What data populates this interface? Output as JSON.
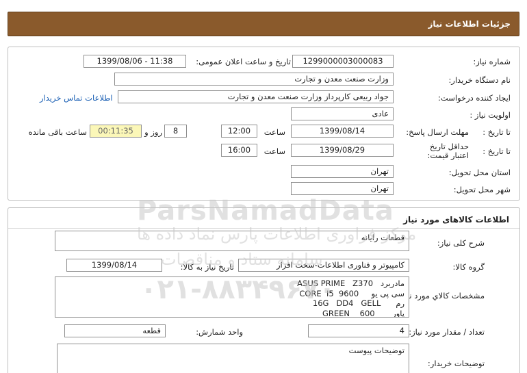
{
  "header": {
    "title": "جزئیات اطلاعات نیاز"
  },
  "need": {
    "number_label": "شماره نیاز:",
    "number_value": "1299000003000083",
    "announce_label": "تاریخ و ساعت اعلان عمومی:",
    "announce_value": "1399/08/06 - 11:38",
    "buyer_label": "نام دستگاه خریدار:",
    "buyer_value": "وزارت صنعت معدن و تجارت",
    "creator_label": "ایجاد کننده درخواست:",
    "creator_value": "جواد ربیعی کارپرداز وزارت صنعت معدن و تجارت",
    "contact_link": "اطلاعات تماس خریدار",
    "priority_label": "اولویت نیاز :",
    "priority_value": "عادی",
    "deadline_label": "مهلت ارسال پاسخ:",
    "deadline_to_label": "تا تاریخ :",
    "deadline_date": "1399/08/14",
    "deadline_time_label": "ساعت",
    "deadline_time": "12:00",
    "days_value": "8",
    "days_label": "روز و",
    "remaining_value": "00:11:35",
    "remaining_label": "ساعت باقی مانده",
    "validity_label": "حداقل تاریخ اعتبار قیمت:",
    "validity_to_label": "تا تاریخ :",
    "validity_date": "1399/08/29",
    "validity_time_label": "ساعت",
    "validity_time": "16:00",
    "province_label": "استان محل تحویل:",
    "province_value": "تهران",
    "city_label": "شهر محل تحویل:",
    "city_value": "تهران"
  },
  "goods": {
    "section_title": "اطلاعات کالاهای مورد نیاز",
    "desc_label": "شرح کلی نیاز:",
    "desc_value": "قطعات رایانه",
    "group_label": "گروه کالا:",
    "group_value": "کامپیوتر و فناوری اطلاعات-سخت افزار",
    "need_date_label": "تاریخ نیاز به کالا:",
    "need_date_value": "1399/08/14",
    "spec_label": "مشخصات کالاي مورد نياز:",
    "spec_lines": [
      "مادربرد   ASUS PRIME   Z370",
      "سی پی یو     CORE  I5  9600",
      "رم      16G   DD4   GELL",
      "پاور       GREEN    600"
    ],
    "qty_label": "تعداد / مقدار مورد نیاز:",
    "qty_value": "4",
    "unit_label": "واحد شمارش:",
    "unit_value": "قطعه",
    "buyer_notes_label": "توضیحات خریدار:",
    "buyer_notes_value": "توضیحات پیوست"
  },
  "watermark": {
    "brand": "ParsNamadData",
    "line1": "مرکز فراوری اطلاعات پارس نماد داده ها",
    "line2": "سامانه ستاد و مناقصات",
    "phone": "۰۲۱-۸۸۳۴۹۶۷۰"
  }
}
